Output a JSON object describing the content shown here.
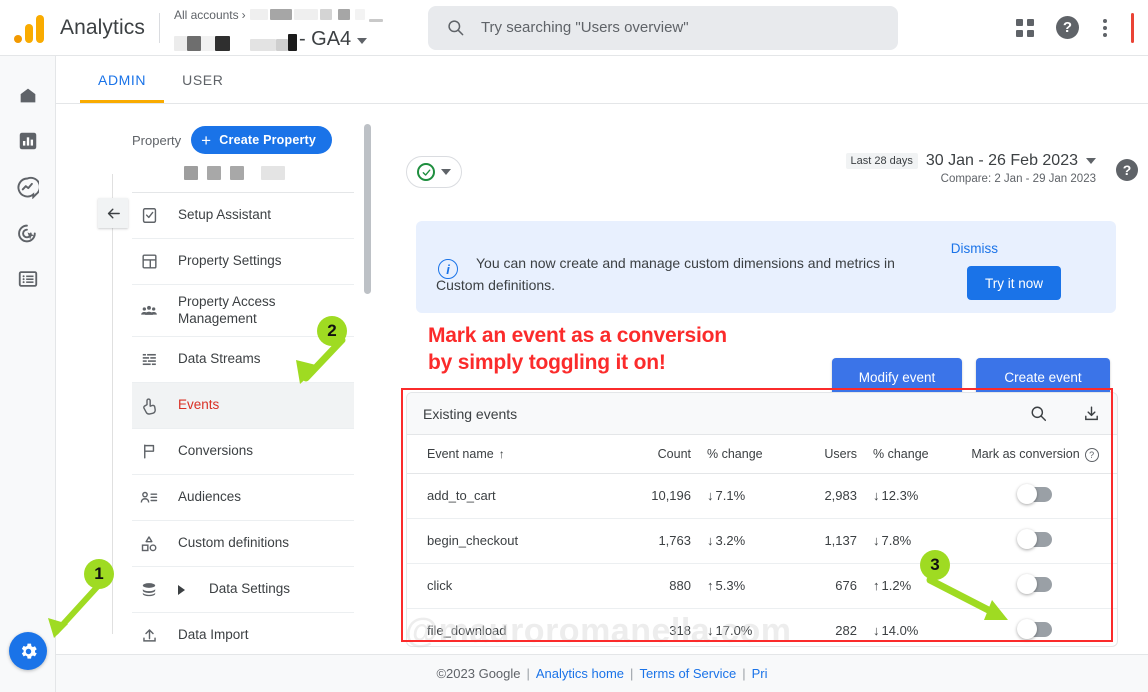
{
  "topbar": {
    "brand": "Analytics",
    "account_breadcrumb": "All accounts",
    "account_chevron": "›",
    "property_suffix": "- GA4",
    "search_placeholder": "Try searching \"Users overview\"",
    "icons": {
      "search": "search-icon",
      "apps": "apps-grid-icon",
      "help": "?",
      "more": "kebab-menu-icon"
    }
  },
  "rail": {
    "items": [
      {
        "name": "home-icon",
        "label": "Home"
      },
      {
        "name": "reports-icon",
        "label": "Reports"
      },
      {
        "name": "explore-icon",
        "label": "Explore"
      },
      {
        "name": "advertising-icon",
        "label": "Advertising"
      },
      {
        "name": "configure-icon",
        "label": "Configure"
      }
    ],
    "settings_fab": "gear-icon"
  },
  "tabs": [
    {
      "label": "ADMIN",
      "active": true
    },
    {
      "label": "USER",
      "active": false
    }
  ],
  "nav": {
    "property_label": "Property",
    "create_property_button": "Create Property",
    "create_property_plus": "+",
    "items": [
      {
        "label": "Setup Assistant",
        "icon": "clipboard-check-icon",
        "active": false
      },
      {
        "label": "Property Settings",
        "icon": "layout-icon",
        "active": false
      },
      {
        "label": "Property Access Management",
        "icon": "people-icon",
        "active": false
      },
      {
        "label": "Data Streams",
        "icon": "streams-icon",
        "active": false
      },
      {
        "label": "Events",
        "icon": "tap-icon",
        "active": true
      },
      {
        "label": "Conversions",
        "icon": "flag-icon",
        "active": false
      },
      {
        "label": "Audiences",
        "icon": "audience-icon",
        "active": false
      },
      {
        "label": "Custom definitions",
        "icon": "shapes-icon",
        "active": false
      },
      {
        "label": "Data Settings",
        "icon": "database-icon",
        "active": false,
        "expandable": true
      },
      {
        "label": "Data Import",
        "icon": "upload-icon",
        "active": false
      }
    ]
  },
  "main": {
    "filter_chip": {
      "name": "all-accounts-filter",
      "icon": "check-circle-icon"
    },
    "date_range": {
      "chip": "Last 28 days",
      "range": "30 Jan - 26 Feb 2023",
      "compare": "Compare: 2 Jan - 29 Jan 2023",
      "help": "?"
    },
    "banner": {
      "icon": "info-icon",
      "text": "You can now create and manage custom dimensions and metrics in Custom definitions.",
      "dismiss": "Dismiss",
      "cta": "Try it now"
    },
    "actions": {
      "modify_event": "Modify event",
      "create_event": "Create event"
    },
    "table": {
      "title": "Existing events",
      "search_icon": "search-icon",
      "download_icon": "download-icon",
      "columns": [
        {
          "label": "Event name",
          "sort": "↑"
        },
        {
          "label": "Count"
        },
        {
          "label": "% change"
        },
        {
          "label": "Users"
        },
        {
          "label": "% change"
        },
        {
          "label": "Mark as conversion",
          "help": "?"
        }
      ],
      "rows": [
        {
          "event": "add_to_cart",
          "count": "10,196",
          "count_change": "7.1%",
          "count_dir": "down",
          "users": "2,983",
          "users_change": "12.3%",
          "users_dir": "down",
          "toggle": false
        },
        {
          "event": "begin_checkout",
          "count": "1,763",
          "count_change": "3.2%",
          "count_dir": "down",
          "users": "1,137",
          "users_change": "7.8%",
          "users_dir": "down",
          "toggle": false
        },
        {
          "event": "click",
          "count": "880",
          "count_change": "5.3%",
          "count_dir": "up",
          "users": "676",
          "users_change": "1.2%",
          "users_dir": "up",
          "toggle": false
        },
        {
          "event": "file_download",
          "count": "318",
          "count_change": "17.0%",
          "count_dir": "down",
          "users": "282",
          "users_change": "14.0%",
          "users_dir": "down",
          "toggle": false
        }
      ]
    }
  },
  "annotations": {
    "callout_line1": "Mark an event as a conversion",
    "callout_line2": "by simply toggling it on!",
    "badges": [
      "1",
      "2",
      "3"
    ],
    "watermark": "@mauroromanella.com",
    "colors": {
      "red": "#fb2b2b",
      "green": "#9fdb22",
      "blue": "#1a73e8"
    }
  },
  "footer": {
    "copyright": "©2023 Google",
    "links": [
      "Analytics home",
      "Terms of Service",
      "Pri"
    ],
    "sep": "|"
  }
}
